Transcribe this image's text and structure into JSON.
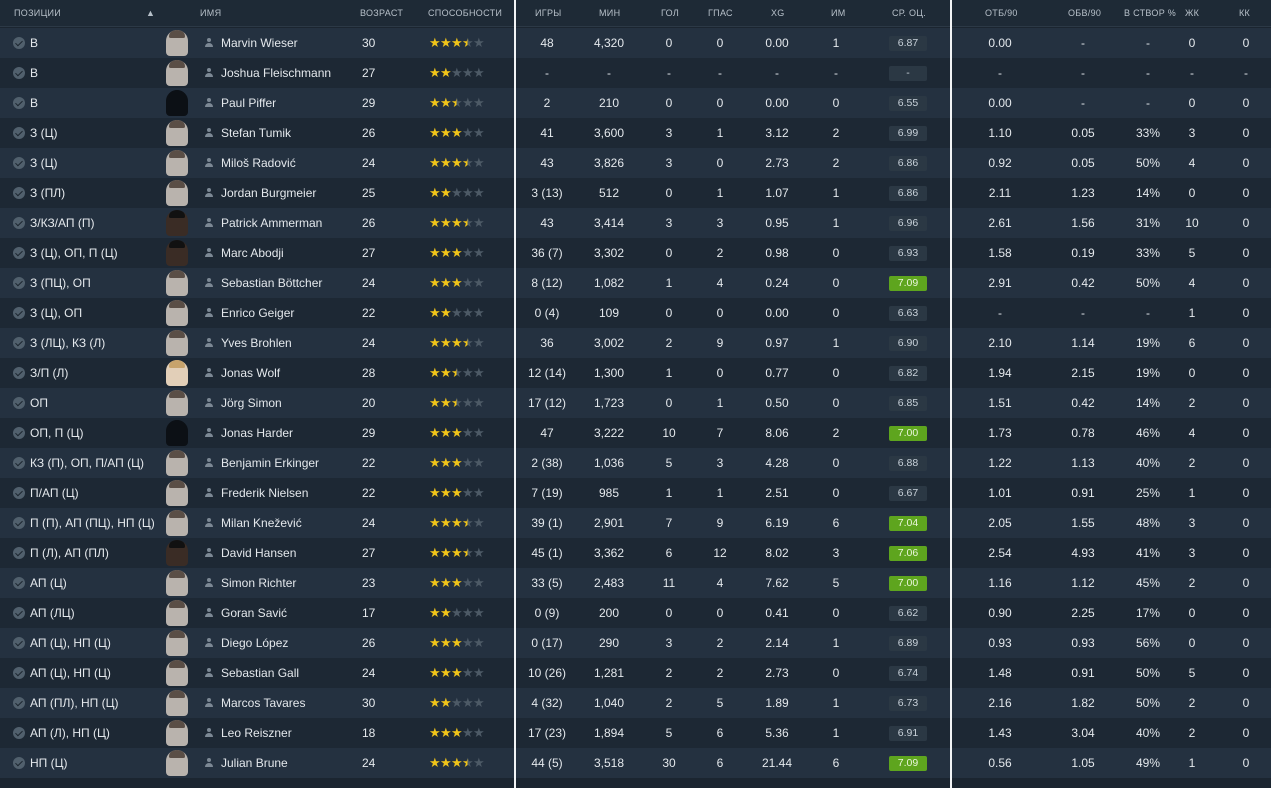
{
  "headers": {
    "position": "ПОЗИЦИИ",
    "name": "ИМЯ",
    "age": "ВОЗРАСТ",
    "ability": "СПОСОБНОСТИ",
    "apps": "ИГРЫ",
    "mins": "МИН",
    "goals": "ГОЛ",
    "assists": "ГПАС",
    "xg": "XG",
    "pom": "ИМ",
    "avg_rating": "СР. ОЦ.",
    "tck90": "ОТБ/90",
    "drb90": "ОБВ/90",
    "shot_on_target": "В СТВОР %",
    "yel": "ЖК",
    "red": "КК"
  },
  "colors": {
    "good_rating": "#5ea51e",
    "star": "#f0c419",
    "separator": "#f2f4f6"
  },
  "players": [
    {
      "position": "В",
      "name": "Marvin Wieser",
      "age": "30",
      "stars": 3.5,
      "face": "normal",
      "apps": "48",
      "mins": "4,320",
      "goals": "0",
      "assists": "0",
      "xg": "0.00",
      "pom": "1",
      "rating": "6.87",
      "good": false,
      "tck90": "0.00",
      "drb90": "-",
      "sot": "-",
      "yel": "0",
      "red": "0"
    },
    {
      "position": "В",
      "name": "Joshua Fleischmann",
      "age": "27",
      "stars": 2,
      "face": "normal",
      "apps": "-",
      "mins": "-",
      "goals": "-",
      "assists": "-",
      "xg": "-",
      "pom": "-",
      "rating": "-",
      "good": false,
      "tck90": "-",
      "drb90": "-",
      "sot": "-",
      "yel": "-",
      "red": "-"
    },
    {
      "position": "В",
      "name": "Paul Piffer",
      "age": "29",
      "stars": 2.5,
      "face": "silh",
      "apps": "2",
      "mins": "210",
      "goals": "0",
      "assists": "0",
      "xg": "0.00",
      "pom": "0",
      "rating": "6.55",
      "good": false,
      "tck90": "0.00",
      "drb90": "-",
      "sot": "-",
      "yel": "0",
      "red": "0"
    },
    {
      "position": "З (Ц)",
      "name": "Stefan Tumik",
      "age": "26",
      "stars": 3,
      "face": "normal",
      "apps": "41",
      "mins": "3,600",
      "goals": "3",
      "assists": "1",
      "xg": "3.12",
      "pom": "2",
      "rating": "6.99",
      "good": false,
      "tck90": "1.10",
      "drb90": "0.05",
      "sot": "33%",
      "yel": "3",
      "red": "0"
    },
    {
      "position": "З (Ц)",
      "name": "Miloš Radović",
      "age": "24",
      "stars": 3.5,
      "face": "normal",
      "apps": "43",
      "mins": "3,826",
      "goals": "3",
      "assists": "0",
      "xg": "2.73",
      "pom": "2",
      "rating": "6.86",
      "good": false,
      "tck90": "0.92",
      "drb90": "0.05",
      "sot": "50%",
      "yel": "4",
      "red": "0"
    },
    {
      "position": "З (ПЛ)",
      "name": "Jordan Burgmeier",
      "age": "25",
      "stars": 2,
      "face": "normal",
      "apps": "3 (13)",
      "mins": "512",
      "goals": "0",
      "assists": "1",
      "xg": "1.07",
      "pom": "1",
      "rating": "6.86",
      "good": false,
      "tck90": "2.11",
      "drb90": "1.23",
      "sot": "14%",
      "yel": "0",
      "red": "0"
    },
    {
      "position": "З/КЗ/АП (П)",
      "name": "Patrick Ammerman",
      "age": "26",
      "stars": 3.5,
      "face": "dark",
      "apps": "43",
      "mins": "3,414",
      "goals": "3",
      "assists": "3",
      "xg": "0.95",
      "pom": "1",
      "rating": "6.96",
      "good": false,
      "tck90": "2.61",
      "drb90": "1.56",
      "sot": "31%",
      "yel": "10",
      "red": "0"
    },
    {
      "position": "З (Ц), ОП, П (Ц)",
      "name": "Marc Abodji",
      "age": "27",
      "stars": 3,
      "face": "dark",
      "apps": "36 (7)",
      "mins": "3,302",
      "goals": "0",
      "assists": "2",
      "xg": "0.98",
      "pom": "0",
      "rating": "6.93",
      "good": false,
      "tck90": "1.58",
      "drb90": "0.19",
      "sot": "33%",
      "yel": "5",
      "red": "0"
    },
    {
      "position": "З (ПЦ), ОП",
      "name": "Sebastian Böttcher",
      "age": "24",
      "stars": 3,
      "face": "normal",
      "apps": "8 (12)",
      "mins": "1,082",
      "goals": "1",
      "assists": "4",
      "xg": "0.24",
      "pom": "0",
      "rating": "7.09",
      "good": true,
      "tck90": "2.91",
      "drb90": "0.42",
      "sot": "50%",
      "yel": "4",
      "red": "0"
    },
    {
      "position": "З (Ц), ОП",
      "name": "Enrico Geiger",
      "age": "22",
      "stars": 2,
      "face": "normal",
      "apps": "0 (4)",
      "mins": "109",
      "goals": "0",
      "assists": "0",
      "xg": "0.00",
      "pom": "0",
      "rating": "6.63",
      "good": false,
      "tck90": "-",
      "drb90": "-",
      "sot": "-",
      "yel": "1",
      "red": "0"
    },
    {
      "position": "З (ЛЦ), КЗ (Л)",
      "name": "Yves Brohlen",
      "age": "24",
      "stars": 3.5,
      "face": "normal",
      "apps": "36",
      "mins": "3,002",
      "goals": "2",
      "assists": "9",
      "xg": "0.97",
      "pom": "1",
      "rating": "6.90",
      "good": false,
      "tck90": "2.10",
      "drb90": "1.14",
      "sot": "19%",
      "yel": "6",
      "red": "0"
    },
    {
      "position": "З/П (Л)",
      "name": "Jonas Wolf",
      "age": "28",
      "stars": 2.5,
      "face": "light",
      "apps": "12 (14)",
      "mins": "1,300",
      "goals": "1",
      "assists": "0",
      "xg": "0.77",
      "pom": "0",
      "rating": "6.82",
      "good": false,
      "tck90": "1.94",
      "drb90": "2.15",
      "sot": "19%",
      "yel": "0",
      "red": "0"
    },
    {
      "position": "ОП",
      "name": "Jörg Simon",
      "age": "20",
      "stars": 2.5,
      "face": "normal",
      "apps": "17 (12)",
      "mins": "1,723",
      "goals": "0",
      "assists": "1",
      "xg": "0.50",
      "pom": "0",
      "rating": "6.85",
      "good": false,
      "tck90": "1.51",
      "drb90": "0.42",
      "sot": "14%",
      "yel": "2",
      "red": "0"
    },
    {
      "position": "ОП, П (Ц)",
      "name": "Jonas Harder",
      "age": "29",
      "stars": 3,
      "face": "silh",
      "apps": "47",
      "mins": "3,222",
      "goals": "10",
      "assists": "7",
      "xg": "8.06",
      "pom": "2",
      "rating": "7.00",
      "good": true,
      "tck90": "1.73",
      "drb90": "0.78",
      "sot": "46%",
      "yel": "4",
      "red": "0"
    },
    {
      "position": "КЗ (П), ОП, П/АП (Ц)",
      "name": "Benjamin Erkinger",
      "age": "22",
      "stars": 3,
      "face": "normal",
      "apps": "2 (38)",
      "mins": "1,036",
      "goals": "5",
      "assists": "3",
      "xg": "4.28",
      "pom": "0",
      "rating": "6.88",
      "good": false,
      "tck90": "1.22",
      "drb90": "1.13",
      "sot": "40%",
      "yel": "2",
      "red": "0"
    },
    {
      "position": "П/АП (Ц)",
      "name": "Frederik Nielsen",
      "age": "22",
      "stars": 3,
      "face": "normal",
      "apps": "7 (19)",
      "mins": "985",
      "goals": "1",
      "assists": "1",
      "xg": "2.51",
      "pom": "0",
      "rating": "6.67",
      "good": false,
      "tck90": "1.01",
      "drb90": "0.91",
      "sot": "25%",
      "yel": "1",
      "red": "0"
    },
    {
      "position": "П (П), АП (ПЦ), НП (Ц)",
      "name": "Milan Knežević",
      "age": "24",
      "stars": 3.5,
      "face": "normal",
      "apps": "39 (1)",
      "mins": "2,901",
      "goals": "7",
      "assists": "9",
      "xg": "6.19",
      "pom": "6",
      "rating": "7.04",
      "good": true,
      "tck90": "2.05",
      "drb90": "1.55",
      "sot": "48%",
      "yel": "3",
      "red": "0"
    },
    {
      "position": "П (Л), АП (ПЛ)",
      "name": "David Hansen",
      "age": "27",
      "stars": 3.5,
      "face": "dark",
      "apps": "45 (1)",
      "mins": "3,362",
      "goals": "6",
      "assists": "12",
      "xg": "8.02",
      "pom": "3",
      "rating": "7.06",
      "good": true,
      "tck90": "2.54",
      "drb90": "4.93",
      "sot": "41%",
      "yel": "3",
      "red": "0"
    },
    {
      "position": "АП (Ц)",
      "name": "Simon Richter",
      "age": "23",
      "stars": 3,
      "face": "normal",
      "apps": "33 (5)",
      "mins": "2,483",
      "goals": "11",
      "assists": "4",
      "xg": "7.62",
      "pom": "5",
      "rating": "7.00",
      "good": true,
      "tck90": "1.16",
      "drb90": "1.12",
      "sot": "45%",
      "yel": "2",
      "red": "0"
    },
    {
      "position": "АП (ЛЦ)",
      "name": "Goran Savić",
      "age": "17",
      "stars": 2,
      "face": "normal",
      "apps": "0 (9)",
      "mins": "200",
      "goals": "0",
      "assists": "0",
      "xg": "0.41",
      "pom": "0",
      "rating": "6.62",
      "good": false,
      "tck90": "0.90",
      "drb90": "2.25",
      "sot": "17%",
      "yel": "0",
      "red": "0"
    },
    {
      "position": "АП (Ц), НП (Ц)",
      "name": "Diego López",
      "age": "26",
      "stars": 3,
      "face": "normal",
      "apps": "0 (17)",
      "mins": "290",
      "goals": "3",
      "assists": "2",
      "xg": "2.14",
      "pom": "1",
      "rating": "6.89",
      "good": false,
      "tck90": "0.93",
      "drb90": "0.93",
      "sot": "56%",
      "yel": "0",
      "red": "0"
    },
    {
      "position": "АП (Ц), НП (Ц)",
      "name": "Sebastian Gall",
      "age": "24",
      "stars": 3,
      "face": "normal",
      "apps": "10 (26)",
      "mins": "1,281",
      "goals": "2",
      "assists": "2",
      "xg": "2.73",
      "pom": "0",
      "rating": "6.74",
      "good": false,
      "tck90": "1.48",
      "drb90": "0.91",
      "sot": "50%",
      "yel": "5",
      "red": "0"
    },
    {
      "position": "АП (ПЛ), НП (Ц)",
      "name": "Marcos Tavares",
      "age": "30",
      "stars": 2,
      "face": "normal",
      "apps": "4 (32)",
      "mins": "1,040",
      "goals": "2",
      "assists": "5",
      "xg": "1.89",
      "pom": "1",
      "rating": "6.73",
      "good": false,
      "tck90": "2.16",
      "drb90": "1.82",
      "sot": "50%",
      "yel": "2",
      "red": "0"
    },
    {
      "position": "АП (Л), НП (Ц)",
      "name": "Leo Reiszner",
      "age": "18",
      "stars": 3,
      "face": "normal",
      "apps": "17 (23)",
      "mins": "1,894",
      "goals": "5",
      "assists": "6",
      "xg": "5.36",
      "pom": "1",
      "rating": "6.91",
      "good": false,
      "tck90": "1.43",
      "drb90": "3.04",
      "sot": "40%",
      "yel": "2",
      "red": "0"
    },
    {
      "position": "НП (Ц)",
      "name": "Julian Brune",
      "age": "24",
      "stars": 3.5,
      "face": "normal",
      "apps": "44 (5)",
      "mins": "3,518",
      "goals": "30",
      "assists": "6",
      "xg": "21.44",
      "pom": "6",
      "rating": "7.09",
      "good": true,
      "tck90": "0.56",
      "drb90": "1.05",
      "sot": "49%",
      "yel": "1",
      "red": "0"
    }
  ]
}
